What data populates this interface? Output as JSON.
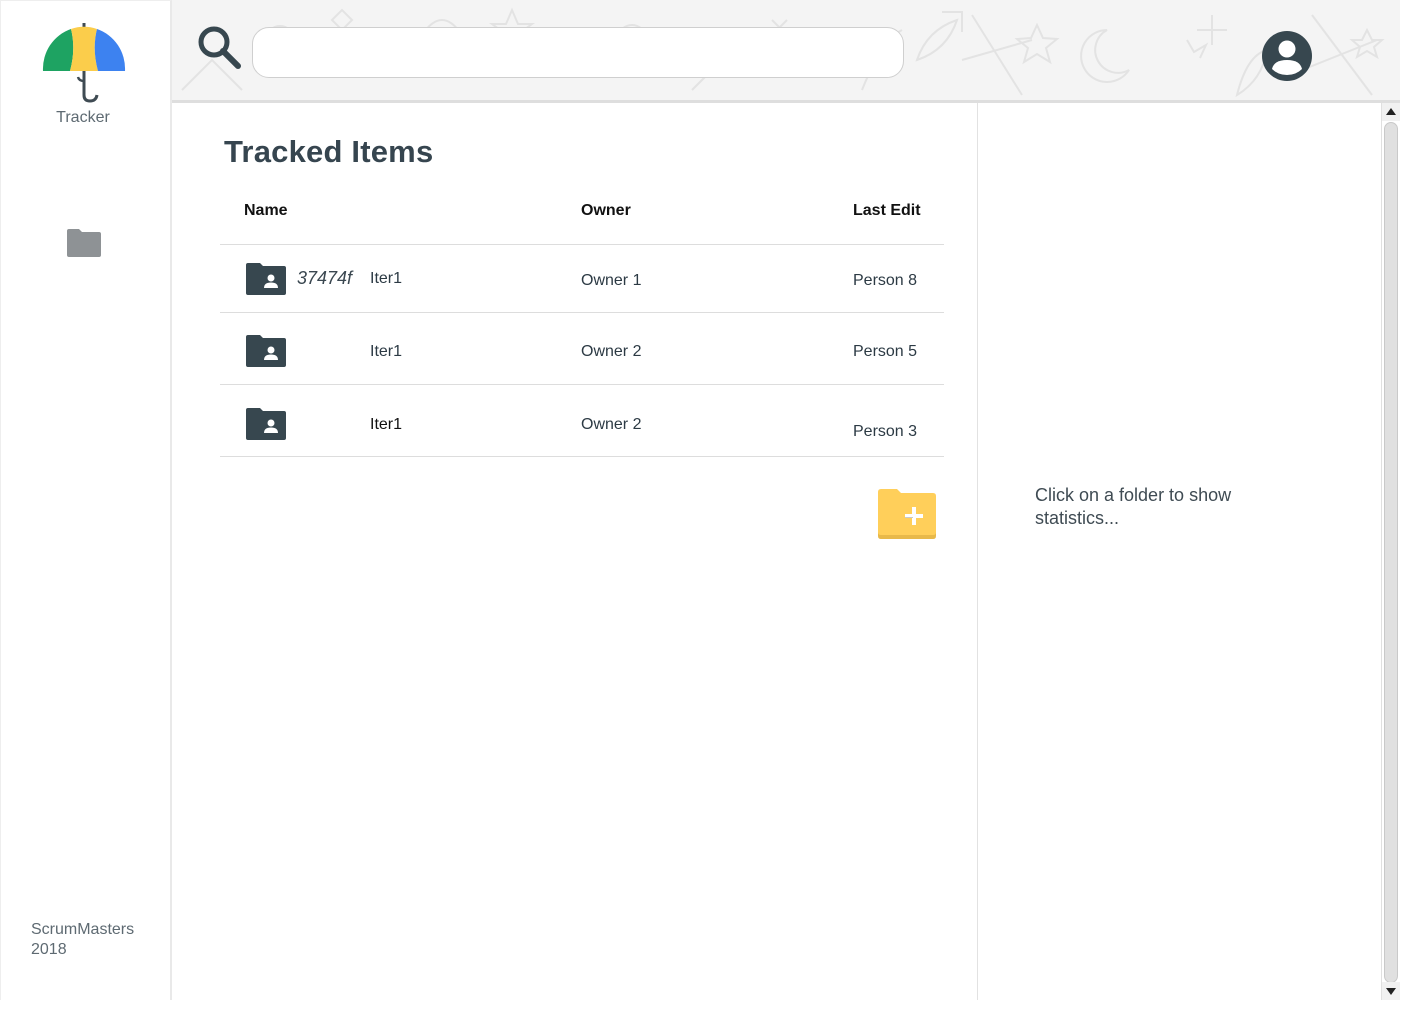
{
  "app": {
    "name": "Tracker"
  },
  "sidebar": {
    "brand": "Tracker",
    "footer_line1": "ScrumMasters",
    "footer_line2": "2018"
  },
  "search": {
    "value": "",
    "placeholder": ""
  },
  "main": {
    "title": "Tracked Items",
    "columns": {
      "name": "Name",
      "owner": "Owner",
      "last_edit": "Last Edit"
    },
    "rows": [
      {
        "hash": "37474f",
        "name": "Iter1",
        "owner": "Owner 1",
        "last_edit": "Person 8"
      },
      {
        "hash": "",
        "name": "Iter1",
        "owner": "Owner 2",
        "last_edit": "Person 5"
      },
      {
        "hash": "",
        "name": "Iter1",
        "owner": "Owner 2",
        "last_edit": "Person 3"
      }
    ]
  },
  "stats": {
    "hint": "Click on a folder to show statistics..."
  },
  "icons": {
    "logo": "umbrella-icon",
    "nav": "folder-icon",
    "search": "search-icon",
    "account": "account-circle-icon",
    "row": "shared-folder-icon",
    "add": "create-folder-icon"
  },
  "colors": {
    "umbrella_green": "#1ea362",
    "umbrella_yellow": "#fbcd4b",
    "umbrella_blue": "#3d82f0",
    "dark_slate": "#37474f",
    "add_folder": "#ffcf5a"
  }
}
